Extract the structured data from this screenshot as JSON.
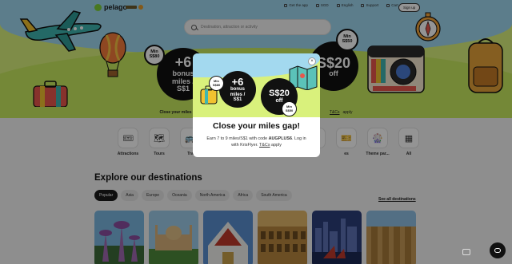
{
  "header": {
    "logo_text": "pelago",
    "nav": [
      {
        "label": "Get the app",
        "icon": "phone-icon"
      },
      {
        "label": "SGD",
        "icon": "currency-icon"
      },
      {
        "label": "English",
        "icon": "globe-icon"
      },
      {
        "label": "Support",
        "icon": "support-icon"
      },
      {
        "label": "Cart",
        "icon": "cart-icon"
      },
      {
        "label": "Log in",
        "icon": ""
      }
    ],
    "signup_label": "Sign up"
  },
  "search": {
    "placeholder": "Destination, attraction or activity"
  },
  "hero": {
    "left_badge": {
      "line1": "+6",
      "line2": "bonus",
      "line3": "miles /",
      "line4": "S$1"
    },
    "left_min": {
      "line1": "Min",
      "line2": "S$80"
    },
    "right_badge": {
      "line1": "S$20",
      "line2": "off"
    },
    "right_min": {
      "line1": "Min",
      "line2": "S$50"
    }
  },
  "promo_strip": {
    "text": "Close your miles g",
    "tc": "T&Cs",
    "suffix": "apply"
  },
  "categories": [
    {
      "label": "Attractions",
      "icon": "ticket-icon",
      "glyph": "🎟"
    },
    {
      "label": "Tours",
      "icon": "map-icon",
      "glyph": "🗺"
    },
    {
      "label": "Tra",
      "icon": "transport-icon",
      "glyph": "🚌"
    },
    {
      "label": "",
      "icon": "hidden-icon",
      "glyph": ""
    },
    {
      "label": "",
      "icon": "hidden-icon",
      "glyph": ""
    },
    {
      "label": "",
      "icon": "hidden-icon",
      "glyph": ""
    },
    {
      "label": "",
      "icon": "hidden-icon",
      "glyph": ""
    },
    {
      "label": "es",
      "icon": "experience-icon",
      "glyph": "🎫"
    },
    {
      "label": "Theme par...",
      "icon": "theme-park-icon",
      "glyph": "🎡"
    },
    {
      "label": "All",
      "icon": "grid-icon",
      "glyph": "▦"
    }
  ],
  "explore": {
    "title": "Explore our destinations",
    "chips": [
      "Popular",
      "Asia",
      "Europe",
      "Oceania",
      "North America",
      "Africa",
      "South America"
    ],
    "active_chip": "Popular",
    "see_all": "See all destinations"
  },
  "modal": {
    "badge1": {
      "line1": "+6",
      "line2": "bonus",
      "line3": "miles /",
      "line4": "S$1"
    },
    "min1": {
      "line1": "Min",
      "line2": "S$80"
    },
    "badge2": {
      "line1": "S$20",
      "line2": "off"
    },
    "min2": {
      "line1": "Min",
      "line2": "S$50"
    },
    "title": "Close your miles gap!",
    "body_pre": "Earn 7 to 9 miles/S$1 with code ",
    "code": "AUGPLUS6",
    "body_mid": ". Log in with KrisFlyer. ",
    "tc": "T&Cs",
    "body_post": " apply",
    "close": "×"
  },
  "colors": {
    "accent": "#d9f17c",
    "sky": "#9fd7ef",
    "dark": "#111111"
  }
}
